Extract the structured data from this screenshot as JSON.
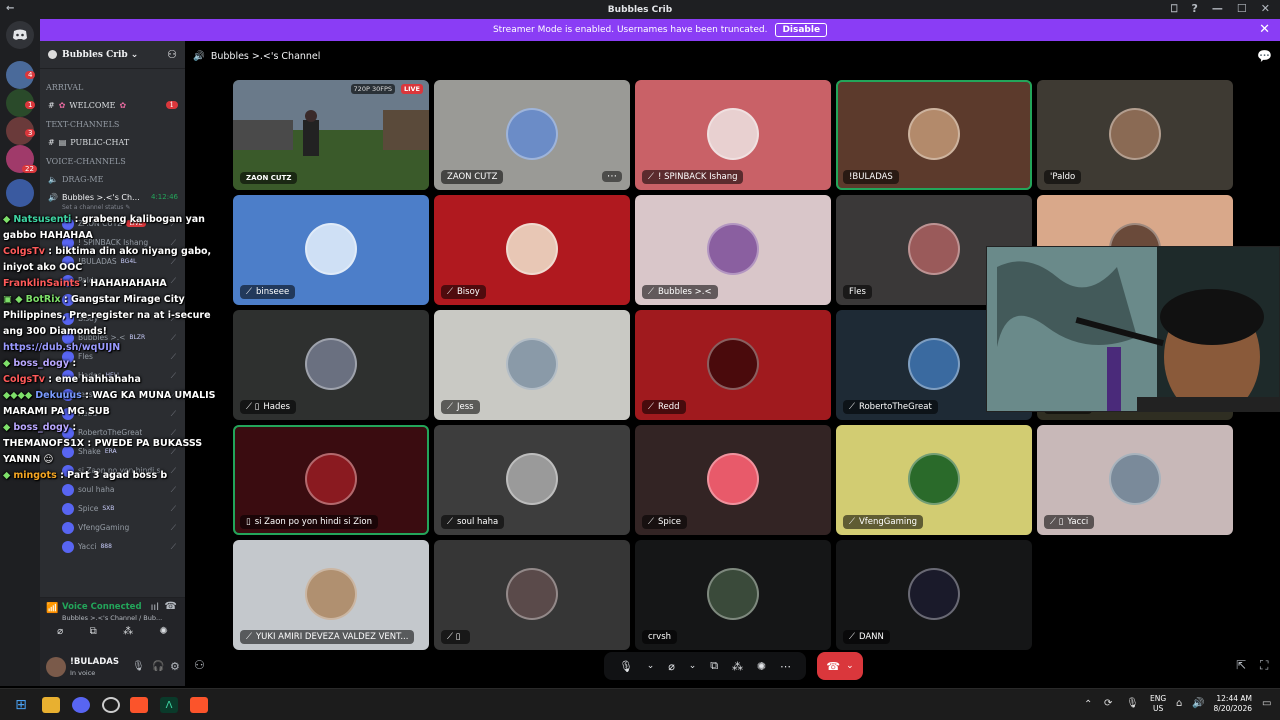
{
  "window": {
    "title": "Bubbles Crib",
    "back": "←",
    "controls": [
      "⎕",
      "?",
      "—",
      "☐",
      "✕"
    ]
  },
  "banner": {
    "text": "Streamer Mode is enabled. Usernames have been truncated.",
    "button": "Disable",
    "close": "✕"
  },
  "guild_badges": [
    "4",
    "1",
    "3",
    "22"
  ],
  "server": {
    "name": "Bubbles Crib",
    "chevron": "⌄"
  },
  "channels": {
    "cat_arrival": "ARRIVAL",
    "welcome": "WELCOME",
    "welcome_badge": "1",
    "cat_text": "TEXT-CHANNELS",
    "public_chat": "PUBLIC-CHAT",
    "cat_voice": "VOICE-CHANNELS",
    "drag_me": "DRAG-ME",
    "bubbles_channel": "Bubbles >.<'s Ch...",
    "timer": "4:12:46",
    "status_placeholder": "Set a channel status ✎"
  },
  "voice_users": [
    {
      "name": "ZAON CUTZ",
      "tag": "LIVE"
    },
    {
      "name": "! SPINBACK Ishang",
      "tag": ""
    },
    {
      "name": "!BULADAS",
      "tag": "BG4L"
    },
    {
      "name": "Paldo",
      "tag": ""
    },
    {
      "name": "binseee",
      "tag": ""
    },
    {
      "name": "Bisoy",
      "tag": ""
    },
    {
      "name": "Bubbles >.<",
      "tag": "BLZR"
    },
    {
      "name": "Fles",
      "tag": ""
    },
    {
      "name": "Hades",
      "tag": "HELL"
    },
    {
      "name": "Jess",
      "tag": ""
    },
    {
      "name": "Redd",
      "tag": ""
    },
    {
      "name": "RobertoTheGreat",
      "tag": ""
    },
    {
      "name": "Shake",
      "tag": "ERA"
    },
    {
      "name": "si Zaon po yon hindi si Zi...",
      "tag": ""
    },
    {
      "name": "soul haha",
      "tag": ""
    },
    {
      "name": "Spice",
      "tag": "SXB"
    },
    {
      "name": "VfengGaming",
      "tag": ""
    },
    {
      "name": "Yacci",
      "tag": "888"
    }
  ],
  "voice_panel": {
    "status": "Voice Connected",
    "sub": "Bubbles >.<'s Channel / Bub..."
  },
  "user_panel": {
    "name": "!BULADAS",
    "status": "In voice"
  },
  "chat_overlay": [
    {
      "icons": "◆",
      "user": "Natsusenti",
      "color": "#3fd6a4",
      "msg": " : grabeng kalibogan yan gabbo HAHAHAA"
    },
    {
      "icons": "",
      "user": "ColgsTv",
      "color": "#ff5a5a",
      "msg": " : biktima din ako niyang gabo, iniyot ako OOC"
    },
    {
      "icons": "",
      "user": "FranklinSaints",
      "color": "#ff5a5a",
      "msg": " : HAHAHAHAHA"
    },
    {
      "icons": "▣ ◆",
      "user": "BotRix",
      "color": "#7ee06a",
      "msg": " : Gangstar Mirage City Philippines, Pre-register na at i-secure ang 300 Diamonds! ",
      "link": "https://dub.sh/wqUIJN"
    },
    {
      "icons": "◆",
      "user": "boss_dogy",
      "color": "#b9a7ff",
      "msg": " :"
    },
    {
      "icons": "",
      "user": "ColgsTv",
      "color": "#ff5a5a",
      "msg": " : eme hahhahaha"
    },
    {
      "icons": "◆◆◆◆",
      "user": "Dekuuus",
      "color": "#7a9bff",
      "msg": " : WAG KA MUNA UMALIS MARAMI PA MG SUB"
    },
    {
      "icons": "◆",
      "user": "boss_dogy",
      "color": "#b9a7ff",
      "msg": " :"
    },
    {
      "icons": "",
      "user": "THEMANOFS1X",
      "color": "#ffffff",
      "msg": " : PWEDE PA BUKASSS YANNN ☺"
    },
    {
      "icons": "◆",
      "user": "mingots",
      "color": "#f5a623",
      "msg": " : Part 3 agad boss b"
    }
  ],
  "stage": {
    "channel": "Bubbles >.<'s Channel"
  },
  "tiles": [
    {
      "name": "ZAON CUTZ",
      "bg": "#3b4a2e",
      "av": "",
      "stream": true,
      "badge": "720P 30FPS",
      "live": "LIVE",
      "hl": false,
      "mute": ""
    },
    {
      "name": "ZAON CUTZ",
      "bg": "#9a9a96",
      "av": "#6b8cc7",
      "stream": false,
      "hl": false,
      "mute": "",
      "more": "⋯"
    },
    {
      "name": "! SPINBACK Ishang",
      "bg": "#c96167",
      "av": "#e8d0d0",
      "hl": false,
      "mute": "⟋"
    },
    {
      "name": "!BULADAS",
      "bg": "#5c3a2c",
      "av": "#b38a6b",
      "hl": true,
      "mute": ""
    },
    {
      "name": "'Paldo",
      "bg": "#3e3a33",
      "av": "#8a6a54",
      "hl": false,
      "mute": ""
    },
    {
      "name": "binseee",
      "bg": "#4c7ec9",
      "av": "#cfe0f5",
      "hl": false,
      "mute": "⟋"
    },
    {
      "name": "Bisoy",
      "bg": "#b0191f",
      "av": "#e8c7b5",
      "hl": false,
      "mute": "⟋"
    },
    {
      "name": "Bubbles >.<",
      "bg": "#d9c6c9",
      "av": "#8a5fa0",
      "hl": false,
      "mute": "⟋"
    },
    {
      "name": "Fles",
      "bg": "#3a3838",
      "av": "#9a5a5a",
      "hl": false,
      "mute": ""
    },
    {
      "name": "",
      "bg": "#d9a88a",
      "av": "#6a4a3a",
      "hl": false,
      "mute": ""
    },
    {
      "name": "Hades",
      "bg": "#2e302f",
      "av": "#6a7080",
      "hl": false,
      "mute": "⟋ ▯"
    },
    {
      "name": "Jess",
      "bg": "#c9c9c4",
      "av": "#8a9aa8",
      "hl": false,
      "mute": "⟋"
    },
    {
      "name": "Redd",
      "bg": "#a01a1e",
      "av": "#4a0a0c",
      "hl": false,
      "mute": "⟋"
    },
    {
      "name": "RobertoTheGreat",
      "bg": "#1e2a35",
      "av": "#3a6aa0",
      "hl": false,
      "mute": "⟋"
    },
    {
      "name": "Shake",
      "bg": "#2f2e22",
      "av": "#6a3a9a",
      "hl": false,
      "mute": "⟋"
    },
    {
      "name": "si Zaon po yon hindi si Zion",
      "bg": "#3a0c10",
      "av": "#8a1a20",
      "hl": true,
      "mute": "▯"
    },
    {
      "name": "soul haha",
      "bg": "#3d3d3d",
      "av": "#9a9a9a",
      "hl": false,
      "mute": "⟋"
    },
    {
      "name": "Spice",
      "bg": "#332424",
      "av": "#e85a6a",
      "hl": false,
      "mute": "⟋"
    },
    {
      "name": "VfengGaming",
      "bg": "#d2cc72",
      "av": "#2a6a2a",
      "hl": false,
      "mute": "⟋"
    },
    {
      "name": "Yacci",
      "bg": "#c8b8b8",
      "av": "#7a8a9a",
      "hl": false,
      "mute": "⟋ ▯"
    },
    {
      "name": "YUKI AMIRI DEVEZA VALDEZ VENT...",
      "bg": "#c4c8cc",
      "av": "#b09070",
      "hl": false,
      "mute": "⟋"
    },
    {
      "name": "",
      "bg": "#363636",
      "av": "#5a4a4a",
      "hl": false,
      "mute": "⟋ ▯"
    },
    {
      "name": "crvsh",
      "bg": "#151617",
      "av": "#3a4a3a",
      "hl": false,
      "mute": ""
    },
    {
      "name": "DANN",
      "bg": "#151617",
      "av": "#1a1a2a",
      "hl": false,
      "mute": "⟋"
    }
  ],
  "controls": {
    "mic": "🎙",
    "cam": "⌀",
    "share": "⧉",
    "activity": "⁂",
    "soundboard": "✺",
    "more": "⋯",
    "hangup": "☎",
    "chevron": "⌄"
  },
  "taskbar": {
    "lang": "ENG",
    "region": "US",
    "time": "12:44 AM",
    "date": "8/20/2026",
    "chevron": "⌃"
  },
  "colors": {
    "banner": "#8a3df5",
    "accent": "#5865f2",
    "danger": "#da373c",
    "voice_green": "#23a55a"
  }
}
